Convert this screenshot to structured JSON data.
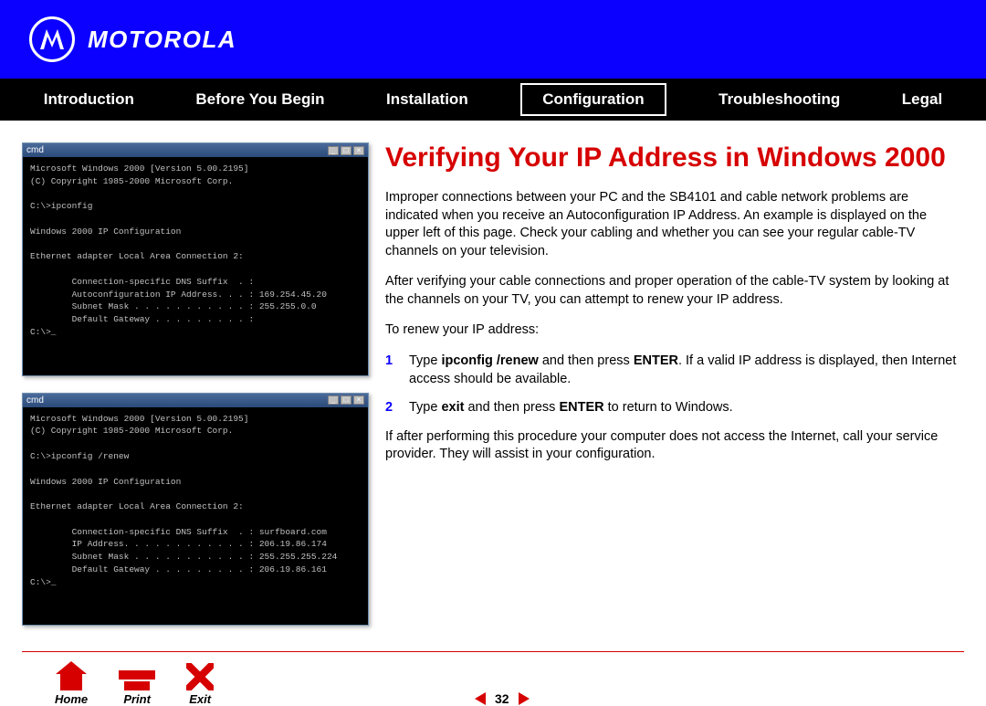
{
  "brand": "MOTOROLA",
  "nav": {
    "items": [
      "Introduction",
      "Before You Begin",
      "Installation",
      "Configuration",
      "Troubleshooting",
      "Legal"
    ],
    "active_index": 3
  },
  "terminals": [
    {
      "title": "cmd",
      "body": "Microsoft Windows 2000 [Version 5.00.2195]\n(C) Copyright 1985-2000 Microsoft Corp.\n\nC:\\>ipconfig\n\nWindows 2000 IP Configuration\n\nEthernet adapter Local Area Connection 2:\n\n        Connection-specific DNS Suffix  . :\n        Autoconfiguration IP Address. . . : 169.254.45.20\n        Subnet Mask . . . . . . . . . . . : 255.255.0.0\n        Default Gateway . . . . . . . . . :\nC:\\>_"
    },
    {
      "title": "cmd",
      "body": "Microsoft Windows 2000 [Version 5.00.2195]\n(C) Copyright 1985-2000 Microsoft Corp.\n\nC:\\>ipconfig /renew\n\nWindows 2000 IP Configuration\n\nEthernet adapter Local Area Connection 2:\n\n        Connection-specific DNS Suffix  . : surfboard.com\n        IP Address. . . . . . . . . . . . : 206.19.86.174\n        Subnet Mask . . . . . . . . . . . : 255.255.255.224\n        Default Gateway . . . . . . . . . : 206.19.86.161\nC:\\>_"
    }
  ],
  "page": {
    "title": "Verifying Your IP Address in Windows 2000",
    "p1": "Improper connections between your PC and the SB4101 and cable network problems are indicated when you receive an Autoconfiguration IP Address. An example is displayed on the upper left of this page. Check your cabling and whether you can see your regular cable-TV channels on your television.",
    "p2": "After verifying your cable connections and proper operation of the cable-TV system by looking at the channels on your TV, you can attempt to renew your IP address.",
    "p3": "To renew your IP address:",
    "steps": [
      {
        "num": "1",
        "pre": "Type ",
        "cmd": "ipconfig /renew",
        "mid": " and then press ",
        "key": "ENTER",
        "post": ". If a valid IP address is displayed, then Internet access should be available."
      },
      {
        "num": "2",
        "pre": "Type ",
        "cmd": "exit",
        "mid": " and then press ",
        "key": "ENTER",
        "post": " to return to Windows."
      }
    ],
    "p4": "If after performing this procedure your computer does not access the Internet, call your service provider. They will assist in your configuration."
  },
  "footer": {
    "buttons": [
      "Home",
      "Print",
      "Exit"
    ],
    "page_number": "32"
  }
}
